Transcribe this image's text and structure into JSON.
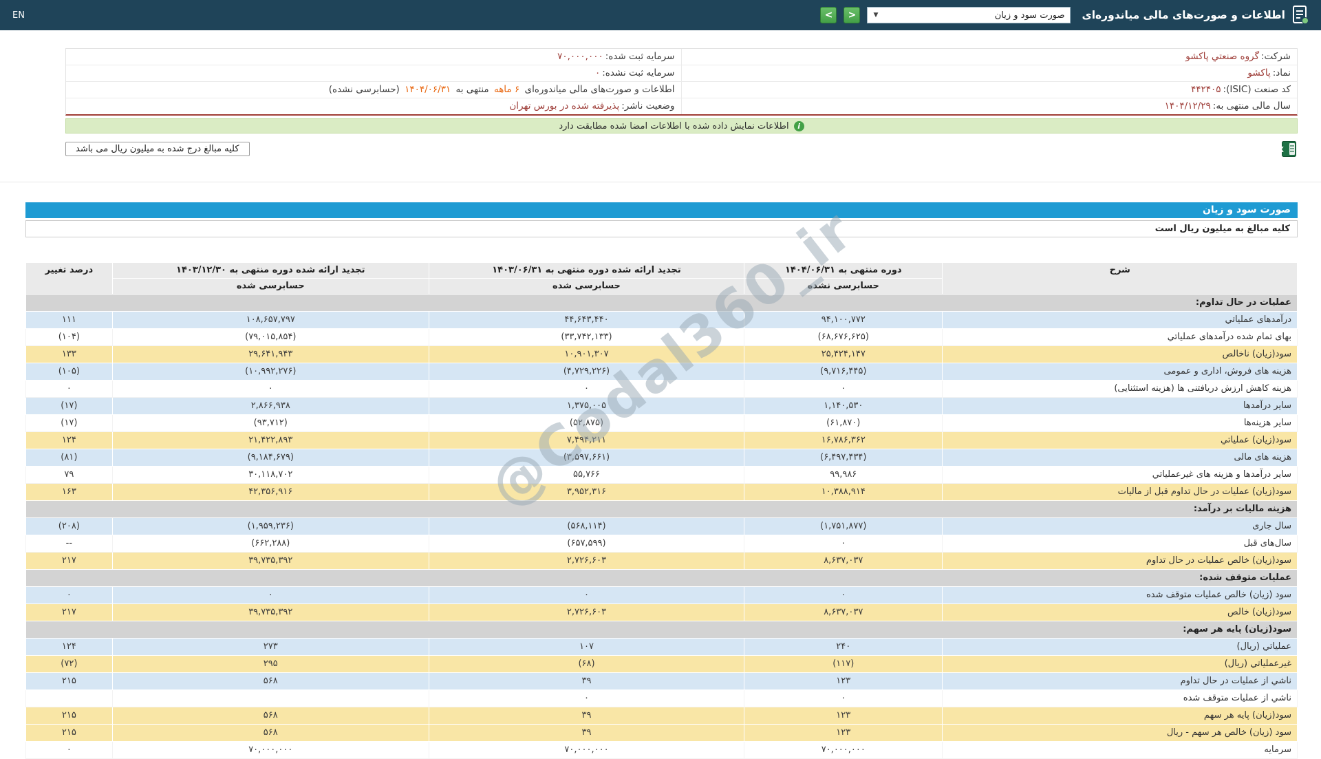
{
  "header": {
    "title": "اطلاعات و صورت‌های مالی میاندوره‌ای",
    "statement_dropdown_value": "صورت سود و زیان",
    "lang_link": "EN"
  },
  "icons": {
    "dropdown_caret": "▼",
    "nav_next": ">",
    "nav_prev": "<",
    "info": "i"
  },
  "company_info": {
    "company_label": "شرکت:",
    "company_value": "گروه صنعتي پاکشو",
    "registered_capital_label": "سرمایه ثبت شده:",
    "registered_capital_value": "۷۰,۰۰۰,۰۰۰",
    "symbol_label": "نماد:",
    "symbol_value": "پاکشو",
    "unregistered_capital_label": "سرمایه ثبت نشده:",
    "unregistered_capital_value": "۰",
    "isic_label": "کد صنعت (ISIC):",
    "isic_value": "۴۴۲۴۰۵",
    "period_info": {
      "prefix": "اطلاعات و صورت‌های مالی میاندوره‌ای",
      "duration": "۶ ماهه",
      "middle": "منتهی به",
      "date": "۱۴۰۴/۰۶/۳۱",
      "suffix": "(حسابرسی نشده)"
    },
    "fiscal_year_label": "سال مالی منتهی به:",
    "fiscal_year_value": "۱۴۰۴/۱۲/۲۹",
    "publisher_status_label": "وضعیت ناشر:",
    "publisher_status_value": "پذیرفته شده در بورس تهران"
  },
  "messages": {
    "signed_match": "اطلاعات نمایش داده شده با اطلاعات امضا شده مطابقت دارد",
    "amounts_note": "کلیه مبالغ درج شده به میلیون ریال می باشد"
  },
  "statement": {
    "title": "صورت سود و زیان",
    "units_note": "کلیه مبالغ به میلیون ریال است",
    "columns": {
      "description": "شرح",
      "col1_title": "دوره منتهی به ۱۴۰۴/۰۶/۳۱",
      "col1_sub": "حسابرسی نشده",
      "col2_title": "تجدید ارائه شده دوره منتهی به ۱۴۰۳/۰۶/۳۱",
      "col2_sub": "حسابرسی شده",
      "col3_title": "تجدید ارائه شده دوره منتهی به ۱۴۰۳/۱۲/۳۰",
      "col3_sub": "حسابرسی شده",
      "change": "درصد تغییر"
    },
    "rows": [
      {
        "type": "section",
        "label": "عملیات در حال تداوم:"
      },
      {
        "type": "data",
        "style": "blue",
        "label": "درآمدهای عملیاتي",
        "values": [
          "۹۴,۱۰۰,۷۷۲",
          "۴۴,۶۴۳,۴۴۰",
          "۱۰۸,۶۵۷,۷۹۷"
        ],
        "change": "۱۱۱"
      },
      {
        "type": "data",
        "style": "white",
        "label": "بهای تمام شده درآمدهای عملیاتي",
        "values": [
          "(۶۸,۶۷۶,۶۲۵)",
          "(۳۳,۷۴۲,۱۳۳)",
          "(۷۹,۰۱۵,۸۵۴)"
        ],
        "change": "(۱۰۴)"
      },
      {
        "type": "data",
        "style": "yellow",
        "label": "سود(زیان) ناخالص",
        "values": [
          "۲۵,۴۲۴,۱۴۷",
          "۱۰,۹۰۱,۳۰۷",
          "۲۹,۶۴۱,۹۴۳"
        ],
        "change": "۱۳۳"
      },
      {
        "type": "data",
        "style": "blue",
        "label": "هزینه های فروش، اداری و عمومی",
        "values": [
          "(۹,۷۱۶,۴۴۵)",
          "(۴,۷۲۹,۲۲۶)",
          "(۱۰,۹۹۲,۲۷۶)"
        ],
        "change": "(۱۰۵)"
      },
      {
        "type": "data",
        "style": "white",
        "label": "هزینه کاهش ارزش دریافتنی ها (هزینه استثنایی)",
        "values": [
          "۰",
          "۰",
          "۰"
        ],
        "change": "۰"
      },
      {
        "type": "data",
        "style": "blue",
        "label": "سایر درآمدها",
        "values": [
          "۱,۱۴۰,۵۳۰",
          "۱,۳۷۵,۰۰۵",
          "۲,۸۶۶,۹۳۸"
        ],
        "change": "(۱۷)"
      },
      {
        "type": "data",
        "style": "white",
        "label": "سایر هزینه‌ها",
        "values": [
          "(۶۱,۸۷۰)",
          "(۵۲,۸۷۵)",
          "(۹۳,۷۱۲)"
        ],
        "change": "(۱۷)"
      },
      {
        "type": "data",
        "style": "yellow",
        "label": "سود(زیان) عملیاتي",
        "values": [
          "۱۶,۷۸۶,۳۶۲",
          "۷,۴۹۴,۲۱۱",
          "۲۱,۴۲۲,۸۹۳"
        ],
        "change": "۱۲۴"
      },
      {
        "type": "data",
        "style": "blue",
        "label": "هزینه های مالی",
        "values": [
          "(۶,۴۹۷,۴۳۴)",
          "(۳,۵۹۷,۶۶۱)",
          "(۹,۱۸۴,۶۷۹)"
        ],
        "change": "(۸۱)"
      },
      {
        "type": "data",
        "style": "white",
        "label": "سایر درآمدها و هزینه های غیرعملیاتي",
        "values": [
          "۹۹,۹۸۶",
          "۵۵,۷۶۶",
          "۳۰,۱۱۸,۷۰۲"
        ],
        "change": "۷۹"
      },
      {
        "type": "data",
        "style": "yellow",
        "label": "سود(زیان) عملیات در حال تداوم قبل از مالیات",
        "values": [
          "۱۰,۳۸۸,۹۱۴",
          "۳,۹۵۲,۳۱۶",
          "۴۲,۳۵۶,۹۱۶"
        ],
        "change": "۱۶۳"
      },
      {
        "type": "section",
        "label": "هزینه مالیات بر درآمد:"
      },
      {
        "type": "data",
        "style": "blue",
        "label": "سال جاری",
        "values": [
          "(۱,۷۵۱,۸۷۷)",
          "(۵۶۸,۱۱۴)",
          "(۱,۹۵۹,۲۳۶)"
        ],
        "change": "(۲۰۸)"
      },
      {
        "type": "data",
        "style": "white",
        "label": "سال‌های قبل",
        "values": [
          "۰",
          "(۶۵۷,۵۹۹)",
          "(۶۶۲,۲۸۸)"
        ],
        "change": "--"
      },
      {
        "type": "data",
        "style": "yellow",
        "label": "سود(زیان) خالص عملیات در حال تداوم",
        "values": [
          "۸,۶۳۷,۰۳۷",
          "۲,۷۲۶,۶۰۳",
          "۳۹,۷۳۵,۳۹۲"
        ],
        "change": "۲۱۷"
      },
      {
        "type": "section",
        "label": "عملیات متوقف شده:"
      },
      {
        "type": "data",
        "style": "blue",
        "label": "سود (زیان) خالص عملیات متوقف شده",
        "values": [
          "۰",
          "۰",
          "۰"
        ],
        "change": "۰"
      },
      {
        "type": "data",
        "style": "yellow",
        "label": "سود(زیان) خالص",
        "values": [
          "۸,۶۳۷,۰۳۷",
          "۲,۷۲۶,۶۰۳",
          "۳۹,۷۳۵,۳۹۲"
        ],
        "change": "۲۱۷"
      },
      {
        "type": "section",
        "label": "سود(زیان) پایه هر سهم:"
      },
      {
        "type": "data",
        "style": "blue",
        "label": "عملیاتي (ریال)",
        "values": [
          "۲۴۰",
          "۱۰۷",
          "۲۷۳"
        ],
        "change": "۱۲۴"
      },
      {
        "type": "data",
        "style": "yellow",
        "label": "غیرعملیاتي (ریال)",
        "values": [
          "(۱۱۷)",
          "(۶۸)",
          "۲۹۵"
        ],
        "change": "(۷۲)"
      },
      {
        "type": "data",
        "style": "blue",
        "label": "ناشي از عملیات در حال تداوم",
        "values": [
          "۱۲۳",
          "۳۹",
          "۵۶۸"
        ],
        "change": "۲۱۵"
      },
      {
        "type": "data",
        "style": "white",
        "label": "ناشي از عملیات متوقف شده",
        "values": [
          "۰",
          "۰",
          ""
        ],
        "change": ""
      },
      {
        "type": "data",
        "style": "yellow",
        "label": "سود(زیان) پایه هر سهم",
        "values": [
          "۱۲۳",
          "۳۹",
          "۵۶۸"
        ],
        "change": "۲۱۵"
      },
      {
        "type": "data",
        "style": "yellow",
        "label": "سود (زیان) خالص هر سهم - ریال",
        "values": [
          "۱۲۳",
          "۳۹",
          "۵۶۸"
        ],
        "change": "۲۱۵"
      },
      {
        "type": "data",
        "style": "white",
        "label": "سرمایه",
        "values": [
          "۷۰,۰۰۰,۰۰۰",
          "۷۰,۰۰۰,۰۰۰",
          "۷۰,۰۰۰,۰۰۰"
        ],
        "change": "۰"
      }
    ]
  },
  "watermark": "@Codal360_ir"
}
